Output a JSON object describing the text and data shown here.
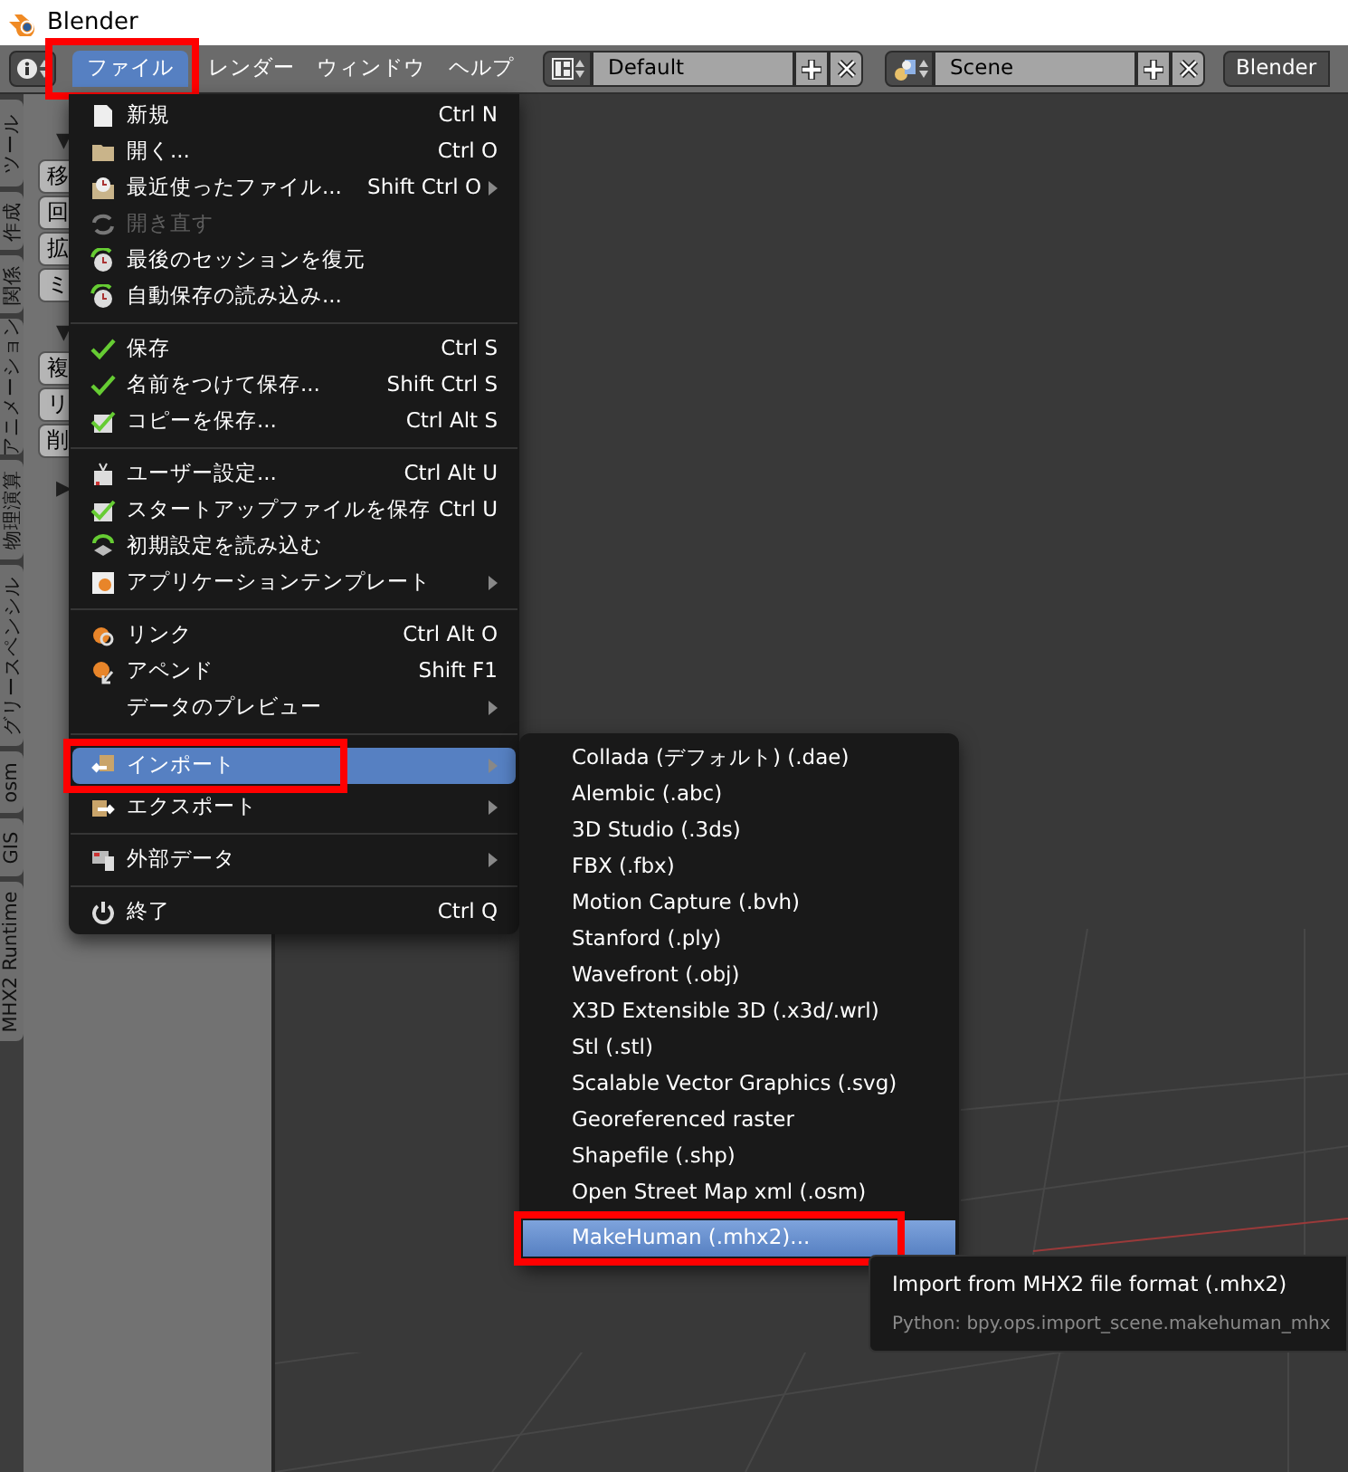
{
  "window": {
    "title": "Blender"
  },
  "header": {
    "menus": [
      {
        "label": "ファイル",
        "selected": true,
        "annotated": true
      },
      {
        "label": "レンダー",
        "selected": false,
        "annotated": false
      },
      {
        "label": "ウィンドウ",
        "selected": false,
        "annotated": false
      },
      {
        "label": "ヘルプ",
        "selected": false,
        "annotated": false
      }
    ],
    "screen_layout": "Default",
    "scene": "Scene",
    "engine": "Blender"
  },
  "tool_tabs": [
    {
      "label": "ツール"
    },
    {
      "label": "作成"
    },
    {
      "label": "関係"
    },
    {
      "label": "アニメーション"
    },
    {
      "label": "物理演算"
    },
    {
      "label": "グリースペンシル"
    },
    {
      "label": "osm"
    },
    {
      "label": "GIS"
    },
    {
      "label": "MHX2 Runtime"
    }
  ],
  "tool_panel": [
    {
      "kind": "heading",
      "label": "▼"
    },
    {
      "kind": "button",
      "label": "移"
    },
    {
      "kind": "button",
      "label": "回"
    },
    {
      "kind": "button",
      "label": "拡"
    },
    {
      "kind": "button",
      "label": "ミ"
    },
    {
      "kind": "heading",
      "label": "▼"
    },
    {
      "kind": "button",
      "label": "複"
    },
    {
      "kind": "button",
      "label": "リ"
    },
    {
      "kind": "button",
      "label": "削"
    },
    {
      "kind": "heading",
      "label": "▶"
    }
  ],
  "file_menu": [
    [
      {
        "label": "新規",
        "shortcut": "Ctrl N",
        "submenu": false,
        "disabled": false,
        "selected": false,
        "annotated": false
      },
      {
        "label": "開く...",
        "shortcut": "Ctrl O",
        "submenu": false,
        "disabled": false,
        "selected": false,
        "annotated": false
      },
      {
        "label": "最近使ったファイル...",
        "shortcut": "Shift Ctrl O",
        "submenu": true,
        "disabled": false,
        "selected": false,
        "annotated": false
      },
      {
        "label": "開き直す",
        "submenu": false,
        "disabled": true,
        "selected": false,
        "annotated": false
      },
      {
        "label": "最後のセッションを復元",
        "submenu": false,
        "disabled": false,
        "selected": false,
        "annotated": false
      },
      {
        "label": "自動保存の読み込み...",
        "submenu": false,
        "disabled": false,
        "selected": false,
        "annotated": false
      }
    ],
    [
      {
        "label": "保存",
        "shortcut": "Ctrl S",
        "submenu": false,
        "disabled": false,
        "selected": false,
        "annotated": false
      },
      {
        "label": "名前をつけて保存...",
        "shortcut": "Shift Ctrl S",
        "submenu": false,
        "disabled": false,
        "selected": false,
        "annotated": false
      },
      {
        "label": "コピーを保存...",
        "shortcut": "Ctrl Alt S",
        "submenu": false,
        "disabled": false,
        "selected": false,
        "annotated": false
      }
    ],
    [
      {
        "label": "ユーザー設定...",
        "shortcut": "Ctrl Alt U",
        "submenu": false,
        "disabled": false,
        "selected": false,
        "annotated": false
      },
      {
        "label": "スタートアップファイルを保存",
        "shortcut": "Ctrl U",
        "submenu": false,
        "disabled": false,
        "selected": false,
        "annotated": false
      },
      {
        "label": "初期設定を読み込む",
        "submenu": false,
        "disabled": false,
        "selected": false,
        "annotated": false
      },
      {
        "label": "アプリケーションテンプレート",
        "submenu": true,
        "disabled": false,
        "selected": false,
        "annotated": false
      }
    ],
    [
      {
        "label": "リンク",
        "shortcut": "Ctrl Alt O",
        "submenu": false,
        "disabled": false,
        "selected": false,
        "annotated": false
      },
      {
        "label": "アペンド",
        "shortcut": "Shift F1",
        "submenu": false,
        "disabled": false,
        "selected": false,
        "annotated": false
      },
      {
        "label": "データのプレビュー",
        "submenu": true,
        "disabled": false,
        "selected": false,
        "annotated": false
      }
    ],
    [
      {
        "label": "インポート",
        "submenu": true,
        "disabled": false,
        "selected": true,
        "annotated": true
      },
      {
        "label": "エクスポート",
        "submenu": true,
        "disabled": false,
        "selected": false,
        "annotated": false
      }
    ],
    [
      {
        "label": "外部データ",
        "submenu": true,
        "disabled": false,
        "selected": false,
        "annotated": false
      }
    ],
    [
      {
        "label": "終了",
        "shortcut": "Ctrl Q",
        "submenu": false,
        "disabled": false,
        "selected": false,
        "annotated": false
      }
    ]
  ],
  "import_menu": [
    {
      "label": "Collada (デフォルト) (.dae)",
      "selected": false,
      "annotated": false
    },
    {
      "label": "Alembic (.abc)",
      "selected": false,
      "annotated": false
    },
    {
      "label": "3D Studio (.3ds)",
      "selected": false,
      "annotated": false
    },
    {
      "label": "FBX (.fbx)",
      "selected": false,
      "annotated": false
    },
    {
      "label": "Motion Capture (.bvh)",
      "selected": false,
      "annotated": false
    },
    {
      "label": "Stanford (.ply)",
      "selected": false,
      "annotated": false
    },
    {
      "label": "Wavefront (.obj)",
      "selected": false,
      "annotated": false
    },
    {
      "label": "X3D Extensible 3D (.x3d/.wrl)",
      "selected": false,
      "annotated": false
    },
    {
      "label": "Stl (.stl)",
      "selected": false,
      "annotated": false
    },
    {
      "label": "Scalable Vector Graphics (.svg)",
      "selected": false,
      "annotated": false
    },
    {
      "label": "Georeferenced raster",
      "selected": false,
      "annotated": false
    },
    {
      "label": "Shapefile (.shp)",
      "selected": false,
      "annotated": false
    },
    {
      "label": "Open Street Map xml (.osm)",
      "selected": false,
      "annotated": false
    },
    {
      "label": "MakeHuman (.mhx2)...",
      "selected": true,
      "annotated": true
    }
  ],
  "tooltip": {
    "description": "Import from MHX2 file format (.mhx2)",
    "python": "Python: bpy.ops.import_scene.makehuman_mhx"
  }
}
